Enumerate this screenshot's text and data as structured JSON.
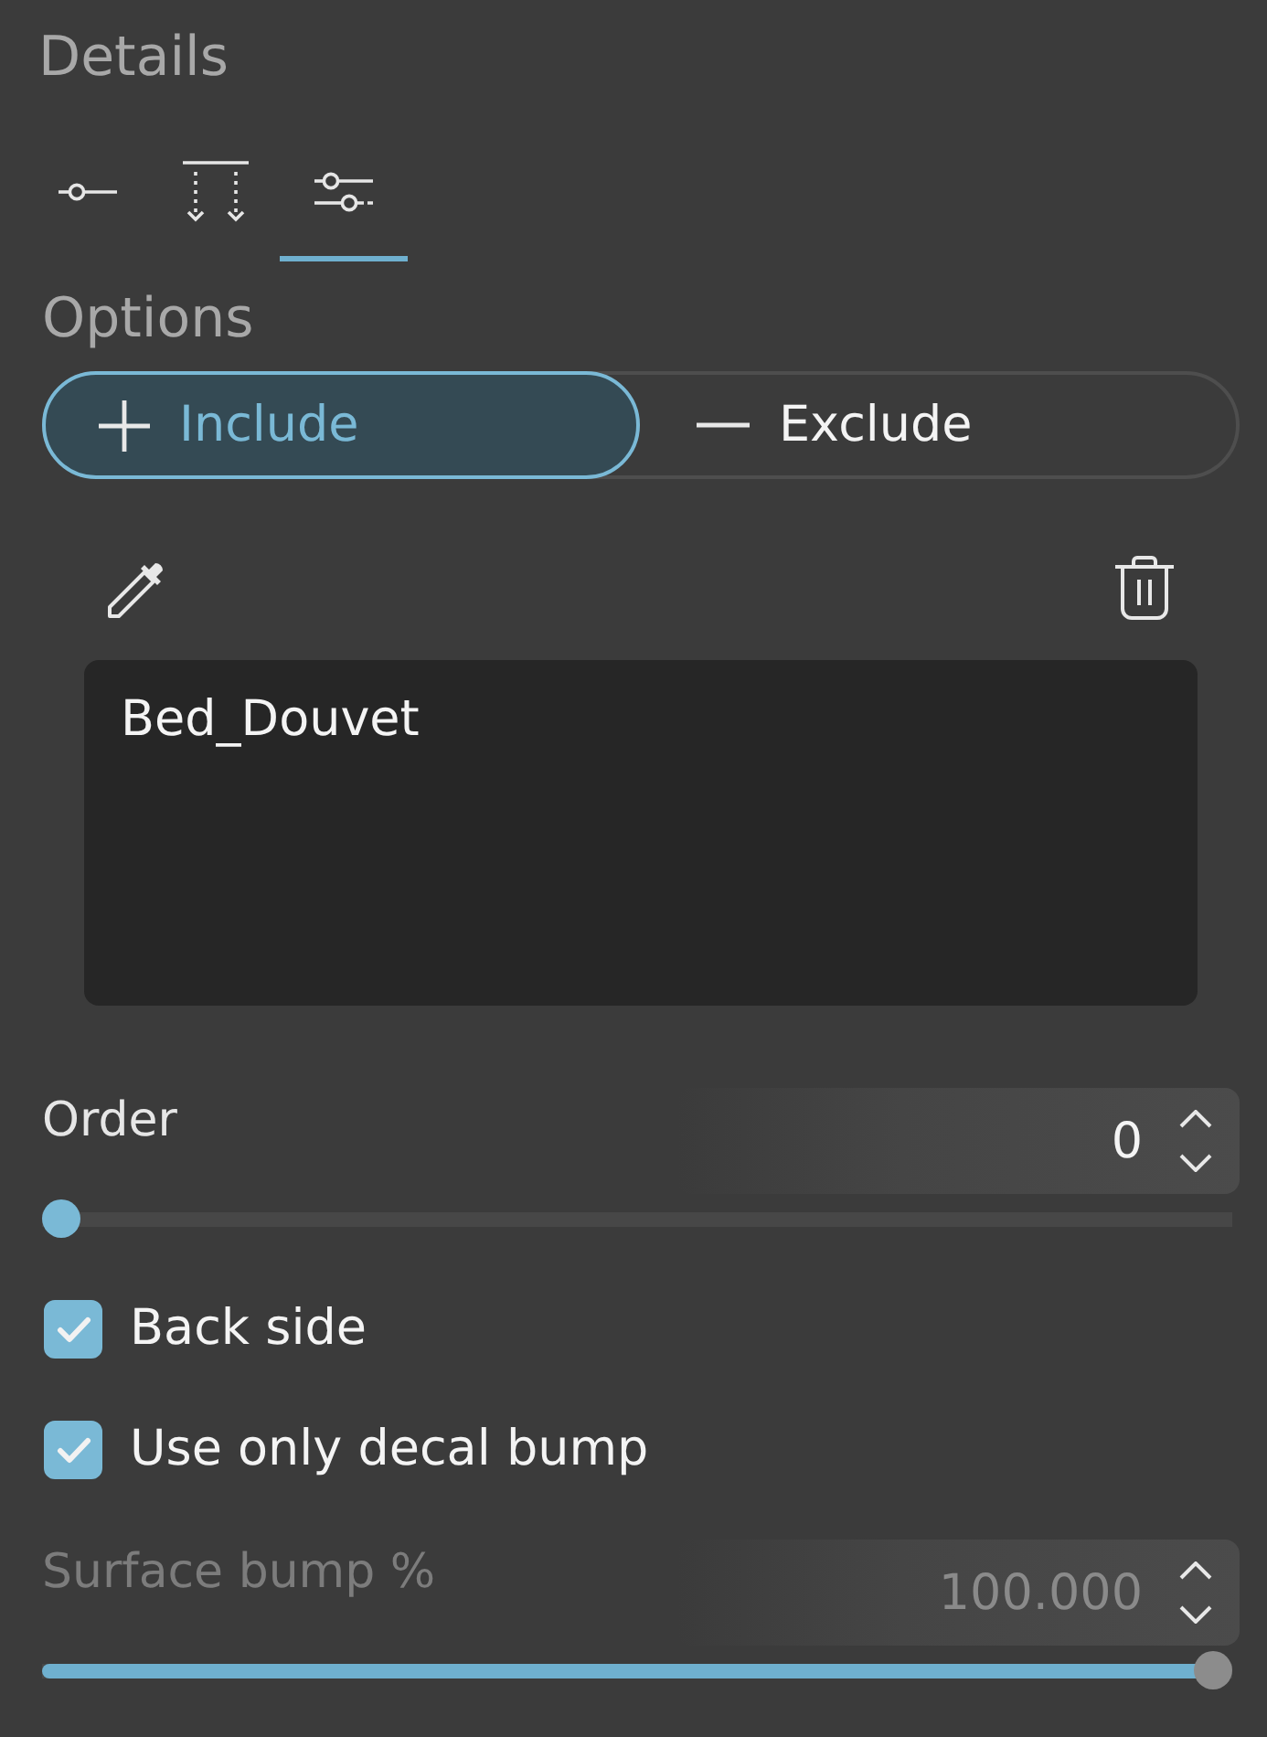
{
  "panel": {
    "title": "Details"
  },
  "tabs": [
    {
      "kind": "node",
      "selected": false
    },
    {
      "kind": "arrows",
      "selected": false
    },
    {
      "kind": "sliders",
      "selected": true
    }
  ],
  "section_title": "Options",
  "mode_toggle": [
    {
      "kind": "plus",
      "label": "Include",
      "selected": true
    },
    {
      "kind": "minus",
      "label": "Exclude",
      "selected": false
    }
  ],
  "object_list": {
    "items": [
      "Bed_Douvet"
    ]
  },
  "settings": [
    {
      "kind": "slider",
      "label": "Order",
      "value": "0",
      "level": 0,
      "disabled": false
    },
    {
      "kind": "checkbox",
      "label": "Back side",
      "checked": true
    },
    {
      "kind": "checkbox",
      "label": "Use only decal bump",
      "checked": true
    },
    {
      "kind": "slider",
      "label": "Surface bump %",
      "value": "100.000",
      "level": 1,
      "disabled": true
    }
  ]
}
